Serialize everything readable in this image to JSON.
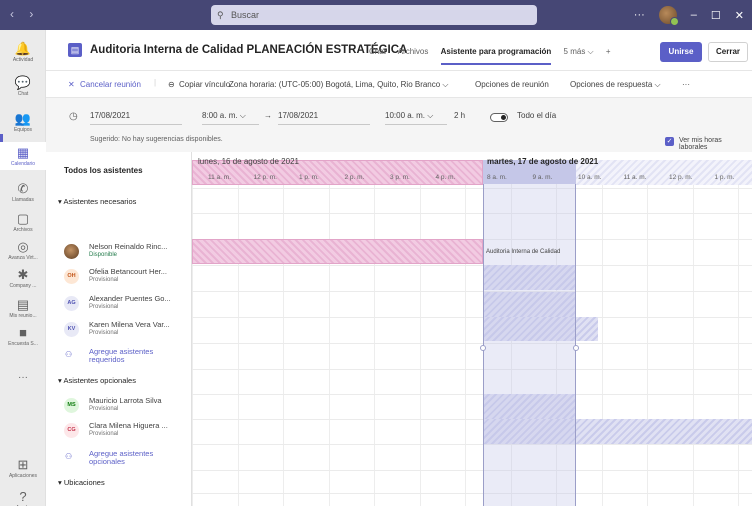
{
  "titlebar": {
    "search_placeholder": "Buscar",
    "more": "···"
  },
  "rail": [
    {
      "label": "Actividad",
      "icon": "bell-icon",
      "glyph": "🔔"
    },
    {
      "label": "Chat",
      "icon": "chat-icon",
      "glyph": "💬"
    },
    {
      "label": "Equipos",
      "icon": "teams-icon",
      "glyph": "👥"
    },
    {
      "label": "Calendario",
      "icon": "calendar-icon",
      "glyph": "▦"
    },
    {
      "label": "Llamadas",
      "icon": "phone-icon",
      "glyph": "✆"
    },
    {
      "label": "Archivos",
      "icon": "file-icon",
      "glyph": "▢"
    },
    {
      "label": "Avanza Virt...",
      "icon": "app-icon",
      "glyph": "◎"
    },
    {
      "label": "Company ...",
      "icon": "company-icon",
      "glyph": "✱"
    },
    {
      "label": "Mis reunio...",
      "icon": "meetings-icon",
      "glyph": "▤"
    },
    {
      "label": "Encuesta S...",
      "icon": "survey-icon",
      "glyph": "■"
    },
    {
      "label": "Aplicaciones",
      "icon": "apps-icon",
      "glyph": "⊞"
    },
    {
      "label": "Ayuda",
      "icon": "help-icon",
      "glyph": "?"
    }
  ],
  "meeting": {
    "title": "Auditoria Interna de Calidad PLANEACIÓN ESTRATÉGICA",
    "tabs": [
      "Chat",
      "Archivos",
      "Asistente para programación",
      "5 más ⌵",
      "+"
    ],
    "join": "Unirse",
    "close": "Cerrar"
  },
  "toolbar": {
    "cancel": "Cancelar reunión",
    "copy": "Copiar vínculo",
    "timezone": "Zona horaria: (UTC-05:00) Bogotá, Lima, Quito, Rio Branco ⌵",
    "options": "Opciones de reunión",
    "response": "Opciones de respuesta ⌵",
    "more": "···"
  },
  "dates": {
    "start_date": "17/08/2021",
    "start_time": "8:00 a. m. ⌵",
    "arrow": "→",
    "end_date": "17/08/2021",
    "end_time": "10:00 a. m. ⌵",
    "duration": "2 h",
    "allday": "Todo el día",
    "suggest": "Sugerido: No hay sugerencias disponibles.",
    "work_hours": "Ver mis horas laborales"
  },
  "days": {
    "monday": "lunes, 16 de agosto de 2021",
    "tuesday": "martes, 17 de agosto de 2021"
  },
  "ticks_mon": [
    "11 a. m.",
    "12 p. m.",
    "1 p. m.",
    "2 p. m.",
    "3 p. m.",
    "4 p. m."
  ],
  "ticks_tue": [
    "8 a. m.",
    "9 a. m.",
    "10 a. m.",
    "11 a. m.",
    "12 p. m.",
    "1 p. m."
  ],
  "sections": {
    "all": "Todos los asistentes",
    "required": "Asistentes necesarios",
    "optional": "Asistentes opcionales",
    "locations": "Ubicaciones"
  },
  "required": [
    {
      "initials": "",
      "name": "Nelson Reinaldo Rinc...",
      "status": "Disponible"
    },
    {
      "initials": "OH",
      "name": "Ofelia Betancourt Her...",
      "status": "Provisional"
    },
    {
      "initials": "AG",
      "name": "Alexander Puentes Go...",
      "status": "Provisional"
    },
    {
      "initials": "KV",
      "name": "Karen Milena Vera Var...",
      "status": "Provisional"
    }
  ],
  "optional": [
    {
      "initials": "MS",
      "name": "Mauricio Larrota Silva",
      "status": "Provisional"
    },
    {
      "initials": "CG",
      "name": "Clara Milena Higuera ...",
      "status": "Provisional"
    }
  ],
  "add_required": "Agregue asistentes requeridos",
  "add_optional": "Agregue asistentes opcionales",
  "meeting_block": "Auditoria Interna de Calidad"
}
